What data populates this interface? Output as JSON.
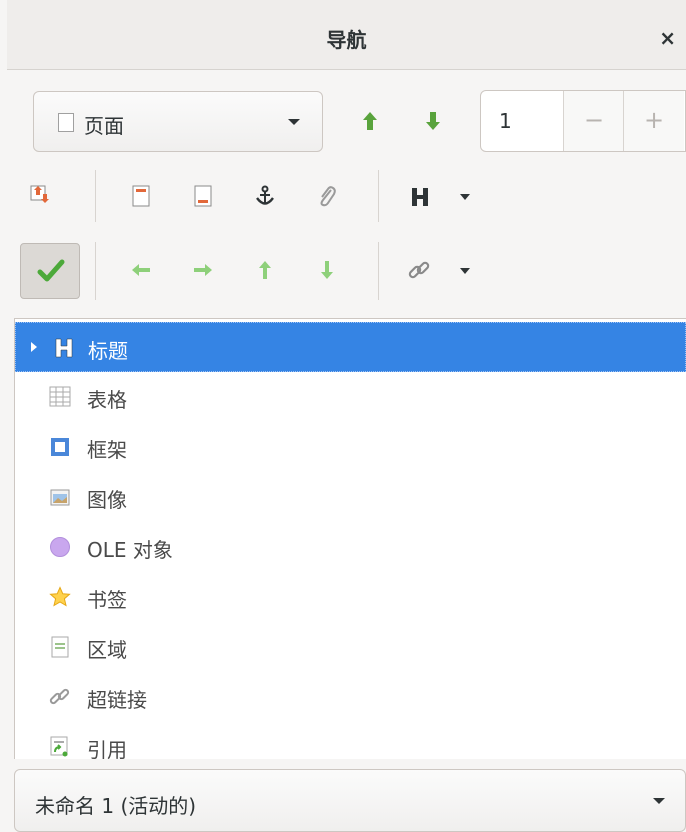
{
  "window": {
    "title": "导航",
    "close_label": "×"
  },
  "toolbar": {
    "navigate_by": {
      "selected": "页面"
    },
    "page_number": "1",
    "spin_minus": "−",
    "spin_plus": "+"
  },
  "tree": {
    "items": [
      {
        "label": "标题",
        "icon": "heading-icon",
        "selected": true
      },
      {
        "label": "表格",
        "icon": "table-icon"
      },
      {
        "label": "框架",
        "icon": "frame-icon"
      },
      {
        "label": "图像",
        "icon": "image-icon"
      },
      {
        "label": "OLE 对象",
        "icon": "ole-object-icon"
      },
      {
        "label": "书签",
        "icon": "bookmark-icon"
      },
      {
        "label": "区域",
        "icon": "section-icon"
      },
      {
        "label": "超链接",
        "icon": "hyperlink-icon"
      },
      {
        "label": "引用",
        "icon": "reference-icon"
      }
    ]
  },
  "footer": {
    "document": "未命名 1 (活动的)"
  },
  "colors": {
    "selection": "#3584e4",
    "green_arrow": "#59a33c",
    "orange": "#e2683a"
  }
}
